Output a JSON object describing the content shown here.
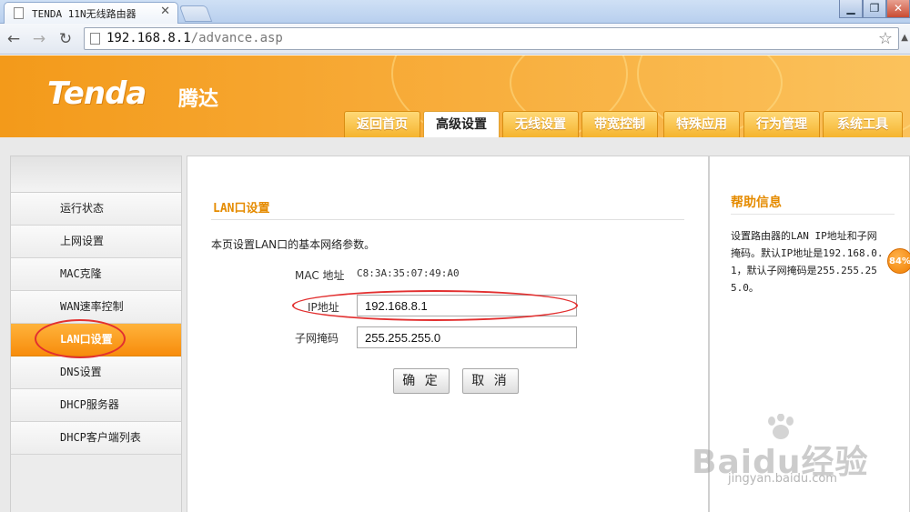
{
  "browser": {
    "tab_title": "TENDA 11N无线路由器",
    "tab_close": "✕",
    "url_host": "192.168.8.1",
    "url_path": "/advance.asp"
  },
  "header": {
    "logo": "Tenda",
    "logo_cn": "腾达",
    "nav": [
      "返回首页",
      "高级设置",
      "无线设置",
      "带宽控制",
      "特殊应用",
      "行为管理",
      "系统工具"
    ],
    "active_nav": "高级设置"
  },
  "sidebar": {
    "items": [
      "运行状态",
      "上网设置",
      "MAC克隆",
      "WAN速率控制",
      "LAN口设置",
      "DNS设置",
      "DHCP服务器",
      "DHCP客户端列表"
    ],
    "active_item": "LAN口设置"
  },
  "main": {
    "section_title": "LAN口设置",
    "description": "本页设置LAN口的基本网络参数。",
    "mac_label": "MAC 地址",
    "mac_value": "C8:3A:35:07:49:A0",
    "ip_label": "IP地址",
    "ip_value": "192.168.8.1",
    "mask_label": "子网掩码",
    "mask_value": "255.255.255.0",
    "confirm_label": "确 定",
    "cancel_label": "取 消"
  },
  "help": {
    "title": "帮助信息",
    "text": "设置路由器的LAN IP地址和子网掩码。默认IP地址是192.168.0.1，默认子网掩码是255.255.255.0。"
  },
  "badge": {
    "percent": "84%"
  },
  "watermark": {
    "main": "Baidu经验",
    "sub": "jingyan.baidu.com"
  },
  "colors": {
    "accent_orange": "#f78c0c",
    "title_orange": "#e58b00",
    "annotation_red": "#e23030"
  }
}
